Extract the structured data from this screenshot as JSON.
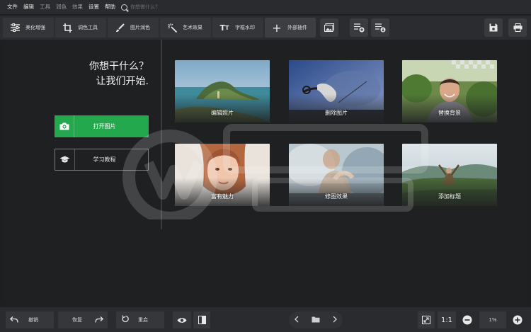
{
  "menu": {
    "items": [
      "文件",
      "编辑",
      "工具",
      "润色",
      "效果",
      "设置",
      "帮助"
    ],
    "search_placeholder": "你想做什么？"
  },
  "toolbar": {
    "tabs": [
      {
        "label": "美化增强",
        "icon": "sliders-icon"
      },
      {
        "label": "调色工具",
        "icon": "crop-icon"
      },
      {
        "label": "图片润色",
        "icon": "brush-icon"
      },
      {
        "label": "艺术效果",
        "icon": "magic-wand-icon"
      },
      {
        "label": "字框水印",
        "icon": "text-icon"
      },
      {
        "label": "外部插件",
        "icon": "plus-icon"
      }
    ]
  },
  "welcome": {
    "line1": "你想干什么？",
    "line2": "让我们开始."
  },
  "actions": {
    "open_label": "打开图片",
    "tutorial_label": "学习教程"
  },
  "cards": [
    {
      "label": "编辑照片"
    },
    {
      "label": "删除图片"
    },
    {
      "label": "替换背景"
    },
    {
      "label": "富有魅力"
    },
    {
      "label": "修图效果"
    },
    {
      "label": "添加标题"
    }
  ],
  "bottom": {
    "undo_label": "撤销",
    "redo_label": "恢复",
    "reset_label": "重启",
    "ratio_label": "1:1",
    "zoom_value": "1%"
  },
  "colors": {
    "accent_green": "#23a84d",
    "background": "#1e1f21"
  }
}
